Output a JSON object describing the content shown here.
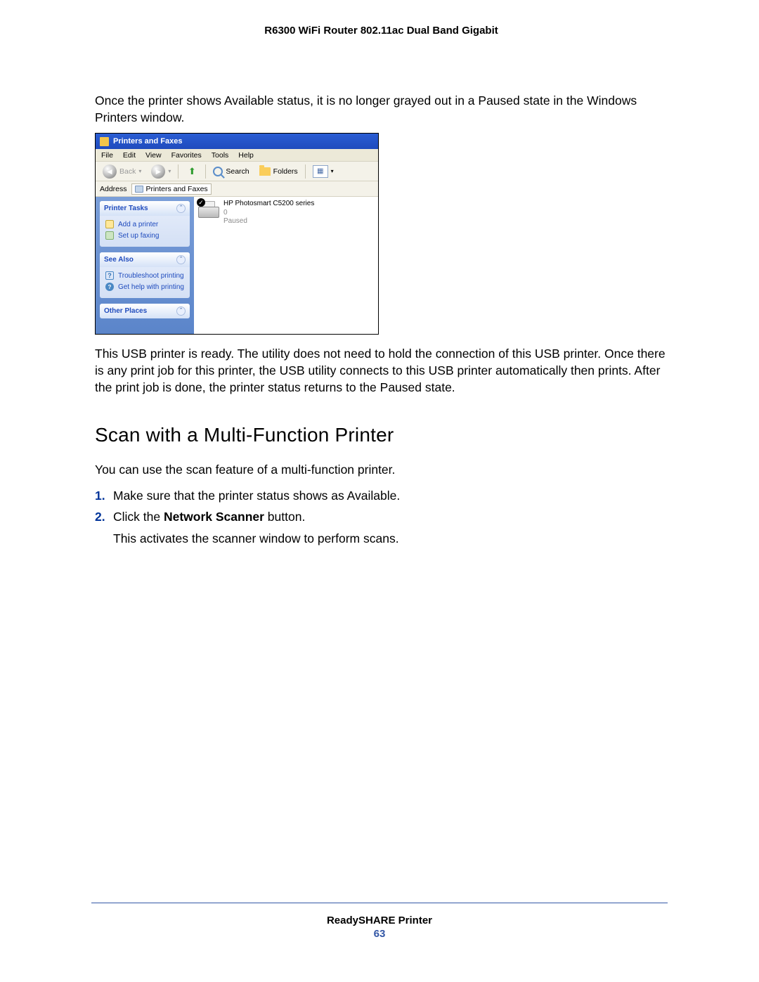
{
  "doc": {
    "header": "R6300 WiFi Router 802.11ac Dual Band Gigabit",
    "footer_label": "ReadySHARE Printer",
    "page_number": "63"
  },
  "paragraphs": {
    "p1": "Once the printer shows Available status, it is no longer grayed out in a Paused state in the Windows Printers window.",
    "p2": "This USB printer is ready. The utility does not need to hold the connection of this USB printer. Once there is any print job for this printer, the USB utility connects to this USB printer automatically then prints. After the print job is done, the printer status returns to the Paused state.",
    "h2": "Scan with a Multi-Function Printer",
    "p3": "You can use the scan feature of a multi-function printer.",
    "step1_num": "1.",
    "step1": "Make sure that the printer status shows as Available.",
    "step2_num": "2.",
    "step2_pre": "Click the ",
    "step2_bold": "Network Scanner",
    "step2_post": " button.",
    "step2_sub": "This activates the scanner window to perform scans."
  },
  "screenshot": {
    "title": "Printers and Faxes",
    "menu": [
      "File",
      "Edit",
      "View",
      "Favorites",
      "Tools",
      "Help"
    ],
    "toolbar": {
      "back": "Back",
      "search": "Search",
      "folders": "Folders"
    },
    "address_label": "Address",
    "address_value": "Printers and Faxes",
    "panels": {
      "printer_tasks": {
        "title": "Printer Tasks",
        "items": [
          "Add a printer",
          "Set up faxing"
        ]
      },
      "see_also": {
        "title": "See Also",
        "items": [
          "Troubleshoot printing",
          "Get help with printing"
        ]
      },
      "other_places": {
        "title": "Other Places"
      }
    },
    "printer": {
      "name": "HP Photosmart C5200 series",
      "docs": "0",
      "status": "Paused"
    }
  }
}
